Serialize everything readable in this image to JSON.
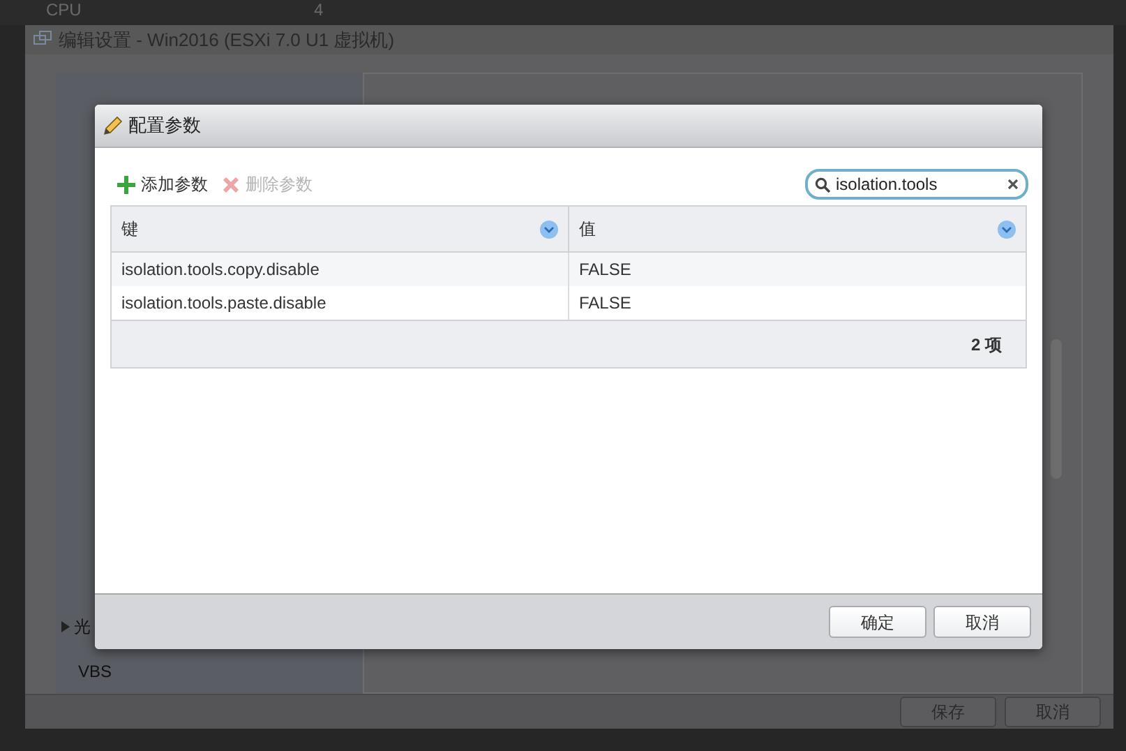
{
  "background": {
    "cpu_label": "CPU",
    "cpu_value": "4"
  },
  "edit_settings": {
    "title": "编辑设置 - Win2016 (ESXi 7.0 U1 虚拟机)",
    "items": [
      {
        "label": "光",
        "kind": "expander"
      },
      {
        "label": "VBS",
        "kind": "plain"
      }
    ],
    "buttons": [
      "保存",
      "取消"
    ]
  },
  "dialog": {
    "title": "配置参数",
    "toolbar": [
      {
        "label": "添加参数",
        "kind": "add",
        "disabled": false
      },
      {
        "label": "删除参数",
        "kind": "delete",
        "disabled": true
      }
    ],
    "search": {
      "value": "isolation.tools"
    },
    "table": {
      "columns": [
        "键",
        "值"
      ],
      "rows": [
        {
          "cells": [
            "isolation.tools.copy.disable",
            "FALSE"
          ]
        },
        {
          "cells": [
            "isolation.tools.paste.disable",
            "FALSE"
          ]
        }
      ],
      "footer": "2 项"
    },
    "buttons": [
      "确定",
      "取消"
    ]
  }
}
